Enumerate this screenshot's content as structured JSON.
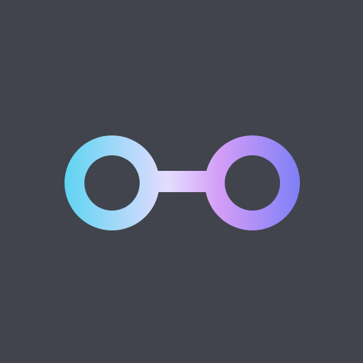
{
  "background_color": "#41444c",
  "logo": {
    "icon": "linked-rings-icon",
    "gradient_colors": [
      "#5fd4f2",
      "#e4dcff",
      "#d39df7",
      "#7f7ff7"
    ]
  }
}
